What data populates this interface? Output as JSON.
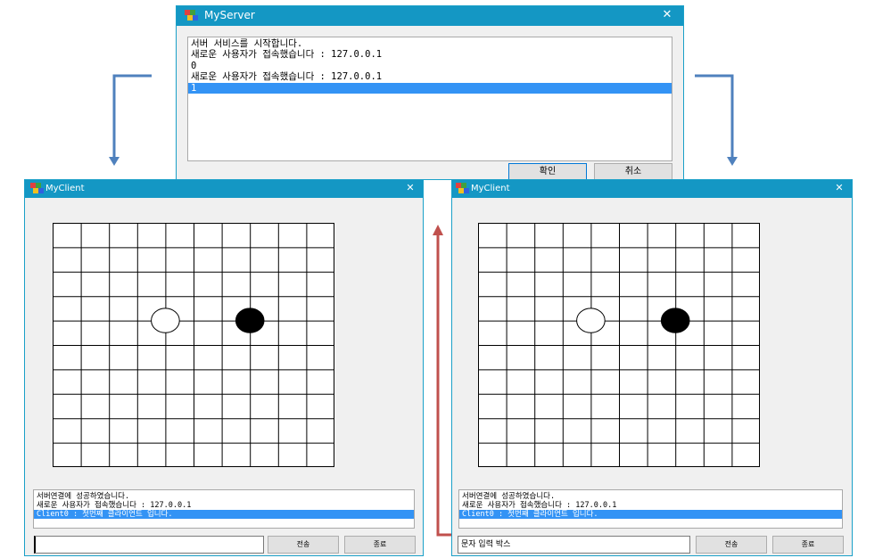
{
  "server": {
    "title": "MyServer",
    "close_glyph": "✕",
    "log": [
      "서버 서비스를 시작합니다.",
      "새로운 사용자가 접속했습니다 : 127.0.0.1",
      "0",
      "새로운 사용자가 접속했습니다 : 127.0.0.1",
      "1"
    ],
    "selected_index": 4,
    "ok_label": "확인",
    "cancel_label": "취소"
  },
  "client_left": {
    "title": "MyClient",
    "close_glyph": "✕",
    "log": [
      "서버연결에 성공하였습니다.",
      "새로운 사용자가 접속했습니다 : 127.0.0.1",
      "Client0 : 첫번째 클라이언트 입니다."
    ],
    "selected_index": 2,
    "input_value": "",
    "send_label": "전송",
    "exit_label": "종료"
  },
  "client_right": {
    "title": "MyClient",
    "close_glyph": "✕",
    "log": [
      "서버연결에 성공하였습니다.",
      "새로운 사용자가 접속했습니다 : 127.0.0.1",
      "Client0 : 첫번째 클라이언트 입니다."
    ],
    "selected_index": 2,
    "input_value": "문자 입력 박스",
    "send_label": "전송",
    "exit_label": "종료"
  },
  "board": {
    "columns": 10,
    "rows": 10,
    "stones": [
      {
        "col": 4,
        "row": 4,
        "color": "white"
      },
      {
        "col": 7,
        "row": 4,
        "color": "black"
      }
    ]
  },
  "colors": {
    "titlebar": "#1497c4",
    "selection": "#3393f5",
    "arrow_blue": "#4f81bd",
    "arrow_red": "#c0504d"
  }
}
